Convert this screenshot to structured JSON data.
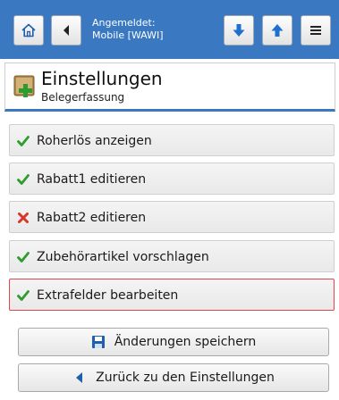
{
  "header": {
    "logged_in_label": "Angemeldet:",
    "logged_in_user": "Mobile [WAWI]"
  },
  "page": {
    "title": "Einstellungen",
    "subtitle": "Belegerfassung"
  },
  "options": [
    {
      "label": "Roherlös anzeigen",
      "state": "enabled"
    },
    {
      "label": "Rabatt1 editieren",
      "state": "enabled"
    },
    {
      "label": "Rabatt2 editieren",
      "state": "disabled"
    },
    {
      "label": "Zubehörartikel vorschlagen",
      "state": "enabled"
    },
    {
      "label": "Extrafelder bearbeiten",
      "state": "enabled",
      "selected": true
    }
  ],
  "actions": {
    "save_label": "Änderungen speichern",
    "back_label": "Zurück zu den Einstellungen"
  },
  "colors": {
    "topbar": "#3a78c2",
    "check": "#2e9d2e",
    "cross": "#d8352a",
    "selection_border": "#e0474c",
    "accent": "#1f5fae"
  }
}
